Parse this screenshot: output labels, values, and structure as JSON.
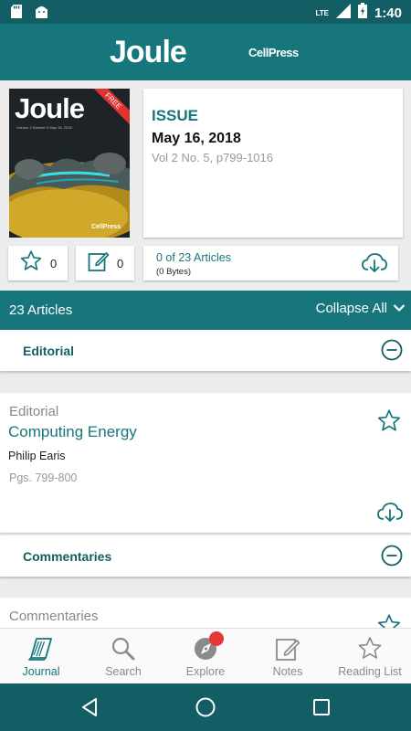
{
  "status_bar": {
    "time": "1:40",
    "network": "LTE",
    "icons": [
      "sd-card-icon",
      "android-icon",
      "signal-icon",
      "battery-icon"
    ]
  },
  "header": {
    "title": "Joule",
    "publisher": "CellPress"
  },
  "cover": {
    "title": "Joule",
    "ribbon": "FREE",
    "subtitle": "Volume 2 Number 5 May 16, 2018",
    "publisher": "CellPress"
  },
  "issue": {
    "label": "ISSUE",
    "date": "May 16, 2018",
    "volume": "Vol 2 No. 5, p799-1016"
  },
  "actions": {
    "favorites_count": "0",
    "notes_count": "0",
    "downloaded": "0 of 23 Articles",
    "size": "(0 Bytes)"
  },
  "list_bar": {
    "count": "23 Articles",
    "collapse": "Collapse All"
  },
  "sections": [
    {
      "name": "Editorial",
      "articles": [
        {
          "type": "Editorial",
          "title": "Computing Energy",
          "author": "Philip Earis",
          "pages": "Pgs. 799-800"
        }
      ]
    },
    {
      "name": "Commentaries",
      "articles": [
        {
          "type": "Commentaries",
          "title": "",
          "author": "",
          "pages": ""
        }
      ]
    }
  ],
  "bottom_nav": [
    {
      "label": "Journal",
      "icon": "journal-icon",
      "active": true
    },
    {
      "label": "Search",
      "icon": "search-icon",
      "active": false
    },
    {
      "label": "Explore",
      "icon": "explore-icon",
      "active": false
    },
    {
      "label": "Notes",
      "icon": "notes-icon",
      "active": false
    },
    {
      "label": "Reading List",
      "icon": "reading-list-icon",
      "active": false
    }
  ],
  "colors": {
    "primary": "#16767c",
    "primary_dark": "#125e64",
    "badge": "#e53935"
  }
}
